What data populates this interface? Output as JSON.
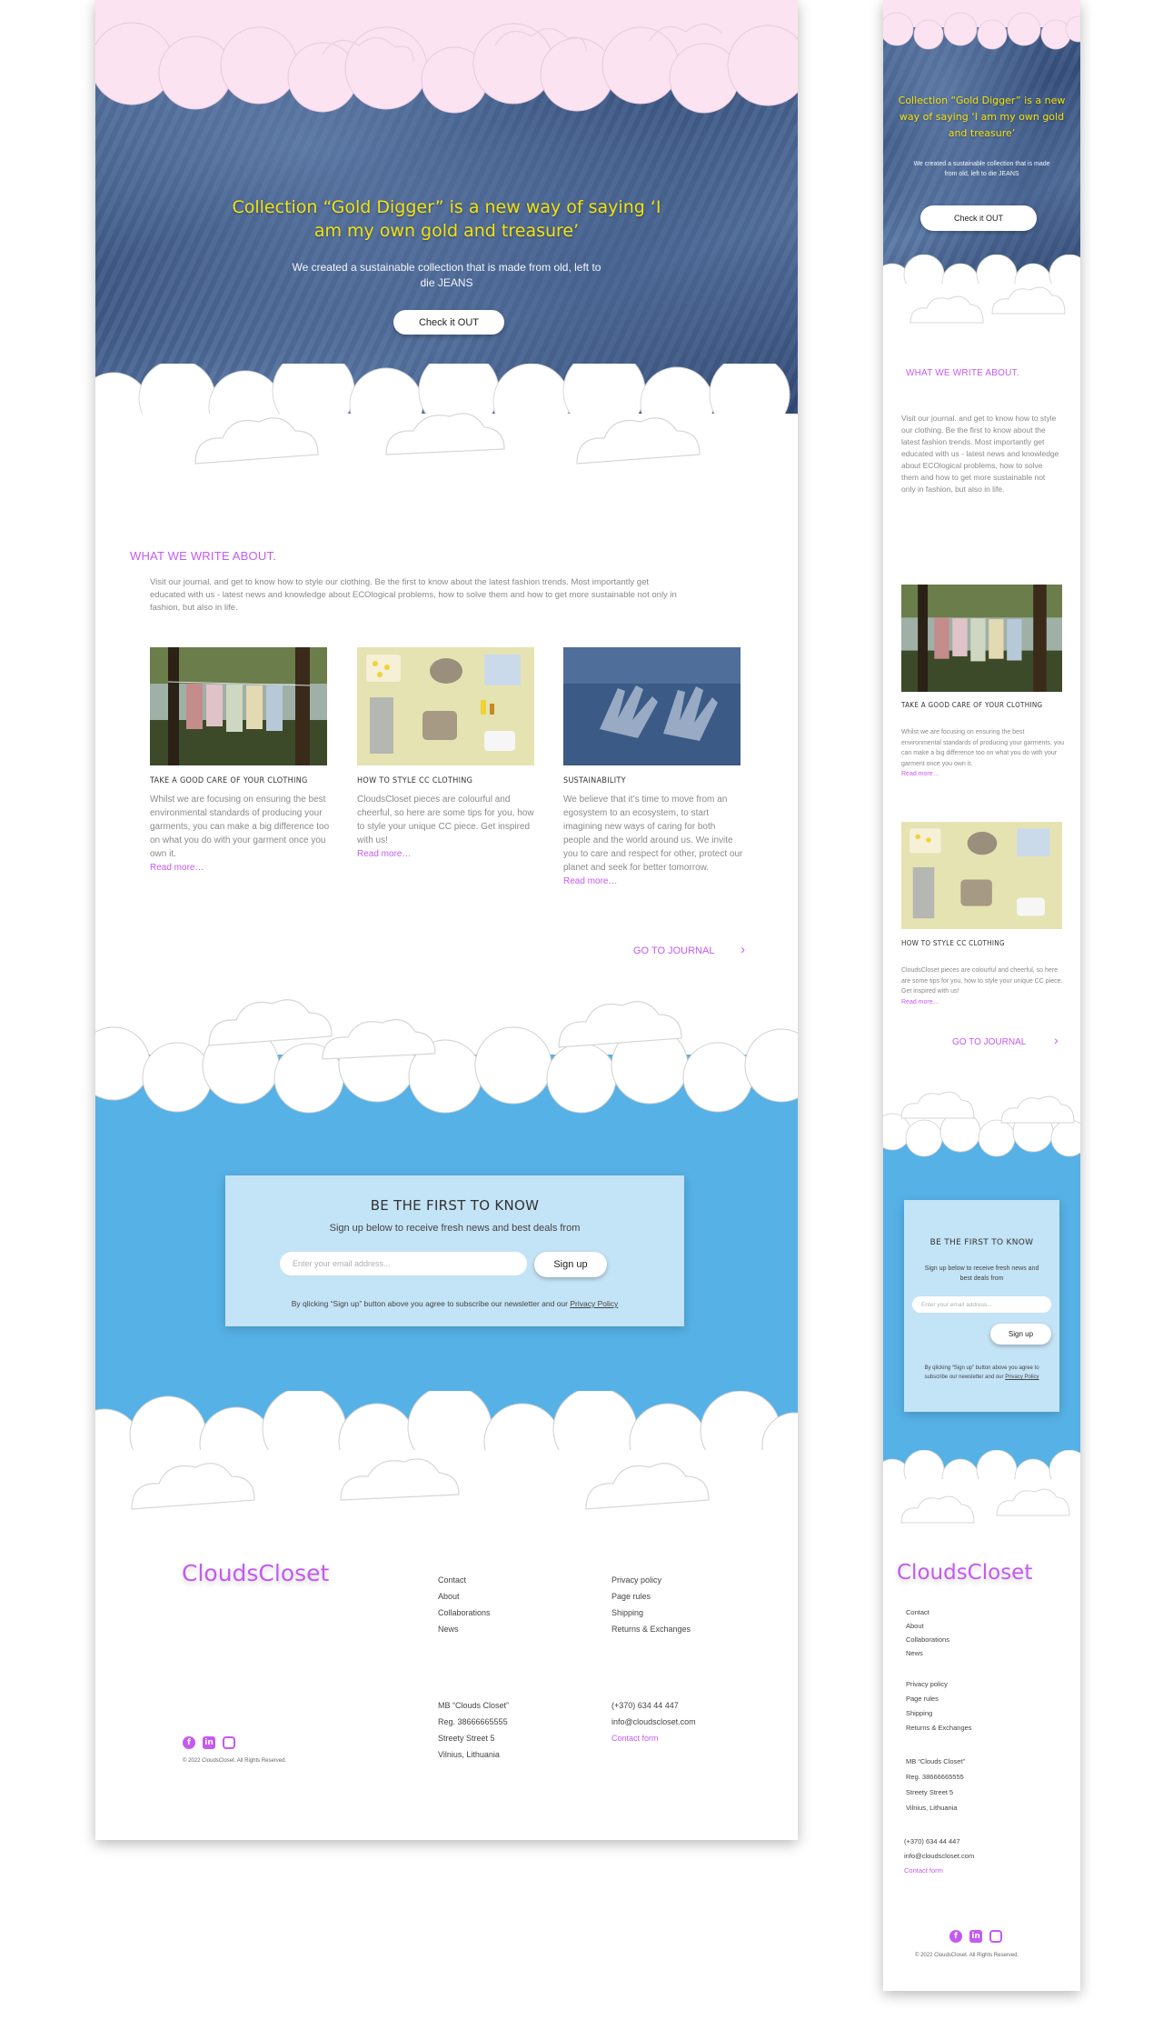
{
  "colors": {
    "accent": "#c45af0",
    "hero_title": "#f3e20c",
    "sky_pink": "#fbe3f1",
    "sky_blue": "#56b1e6",
    "newsletter_bg": "#c3e3f6"
  },
  "hero": {
    "title": "Collection “Gold Digger” is a new way of saying ‘I am my own gold and treasure’",
    "subtitle": "We created a sustainable collection that is made from old, left to die JEANS",
    "cta": "Check it OUT"
  },
  "journal": {
    "heading": "WHAT WE WRITE ABOUT.",
    "intro": "Visit our journal. and get to know how to style our clothing. Be the first to know about the latest fashion trends. Most importantly get educated with us - latest news and knowledge about ECOlogical problems, how to solve them and how to get more sustainable not only in fashion, but also in life.",
    "cards": [
      {
        "title": "TAKE A GOOD CARE OF YOUR CLOTHING",
        "text": "Whilst we are focusing on ensuring the best environmental standards of producing your garments, you can make a big difference too on what you do with your garment once you own it.",
        "link": "Read more…",
        "image": "clothesline-photo"
      },
      {
        "title": "HOW TO STYLE CC CLOTHING",
        "text": "CloudsCloset pieces are colourful and cheerful, so here are some tips for you, how to style your unique CC piece. Get inspired with us!",
        "link": "Read more…",
        "image": "flatlay-outfit-photo"
      },
      {
        "title": "SUSTAINABILITY",
        "text": "We believe that it’s time to move from an egosystem to an ecosystem, to start imagining new ways of caring for both people and the world around us. We invite you to care and respect for other, protect our planet and seek for better tomorrow.",
        "link": "Read more…",
        "image": "denim-gloves-photo"
      }
    ],
    "go_link": "GO TO JOURNAL"
  },
  "newsletter": {
    "title": "BE THE FIRST TO KNOW",
    "subtitle": "Sign up below to receive fresh news and best deals from",
    "email_placeholder": "Enter your email address...",
    "button": "Sign up",
    "legal_prefix": "By qlicking “Sign up” button above you agree to subscribe our newsletter and our",
    "legal_link": "Privacy Policy"
  },
  "footer": {
    "logo": "CloudsCloset",
    "links_col1": [
      "Contact",
      "About",
      "Collaborations",
      "News"
    ],
    "links_col2": [
      "Privacy policy",
      "Page rules",
      "Shipping",
      "Returns & Exchanges"
    ],
    "company": [
      "MB “Clouds Closet”",
      "Reg. 38666665555",
      "Streety Street 5",
      "Vilnius, Lithuania"
    ],
    "contact_phone": "(+370) 634 44 447",
    "contact_email": "info@cloudscloset.com",
    "contact_form": "Contact form",
    "copyright": "© 2022 CloudsCloset. All Rights Reserved.",
    "social_icons": [
      "facebook-icon",
      "linkedin-icon",
      "instagram-icon"
    ]
  }
}
